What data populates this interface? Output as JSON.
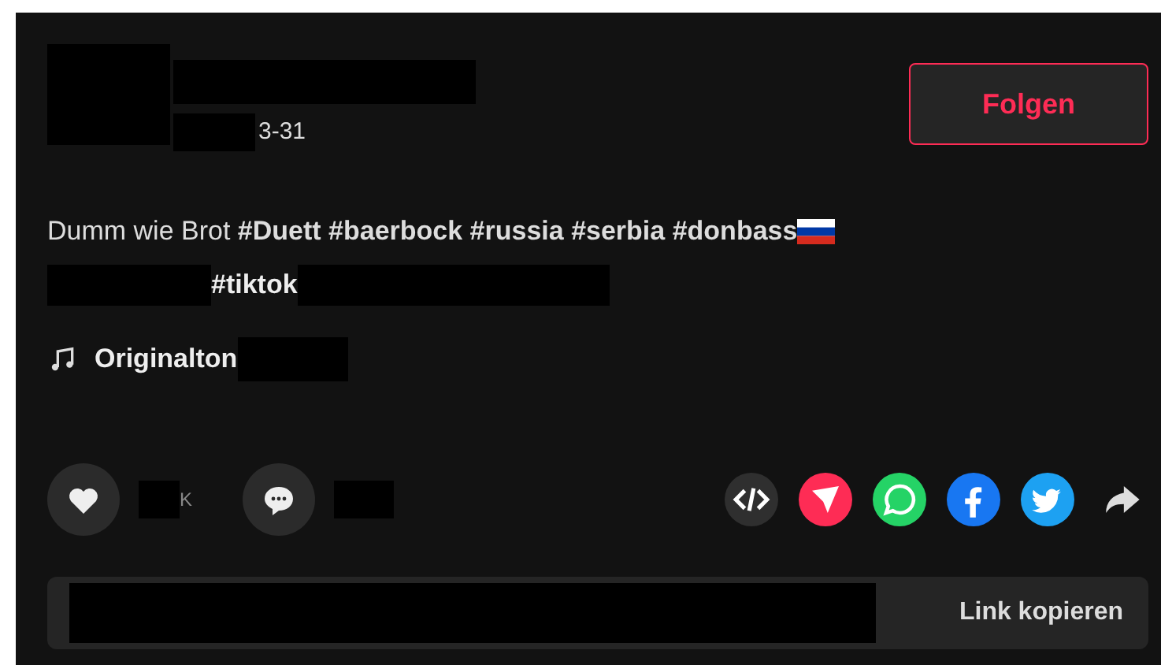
{
  "author": {
    "date": "3-31"
  },
  "follow_button": {
    "label": "Folgen"
  },
  "caption": {
    "text": "Dumm wie Brot **#Duett #baerbock #russia #serbia #donbass**",
    "tag": "#tiktok"
  },
  "sound": {
    "label": "Originalton"
  },
  "actions": {
    "like_suffix": "K"
  },
  "share": {
    "services": [
      {
        "kind": "embed",
        "color": "#2f2f2f"
      },
      {
        "kind": "telegram",
        "color": "#fe2c55"
      },
      {
        "kind": "whatsapp",
        "color": "#25d366"
      },
      {
        "kind": "facebook",
        "color": "#1877f2"
      },
      {
        "kind": "twitter",
        "color": "#1da1f2"
      },
      {
        "kind": "forward",
        "color": "#dddddd"
      }
    ]
  },
  "link_bar": {
    "button": "Link kopieren"
  }
}
